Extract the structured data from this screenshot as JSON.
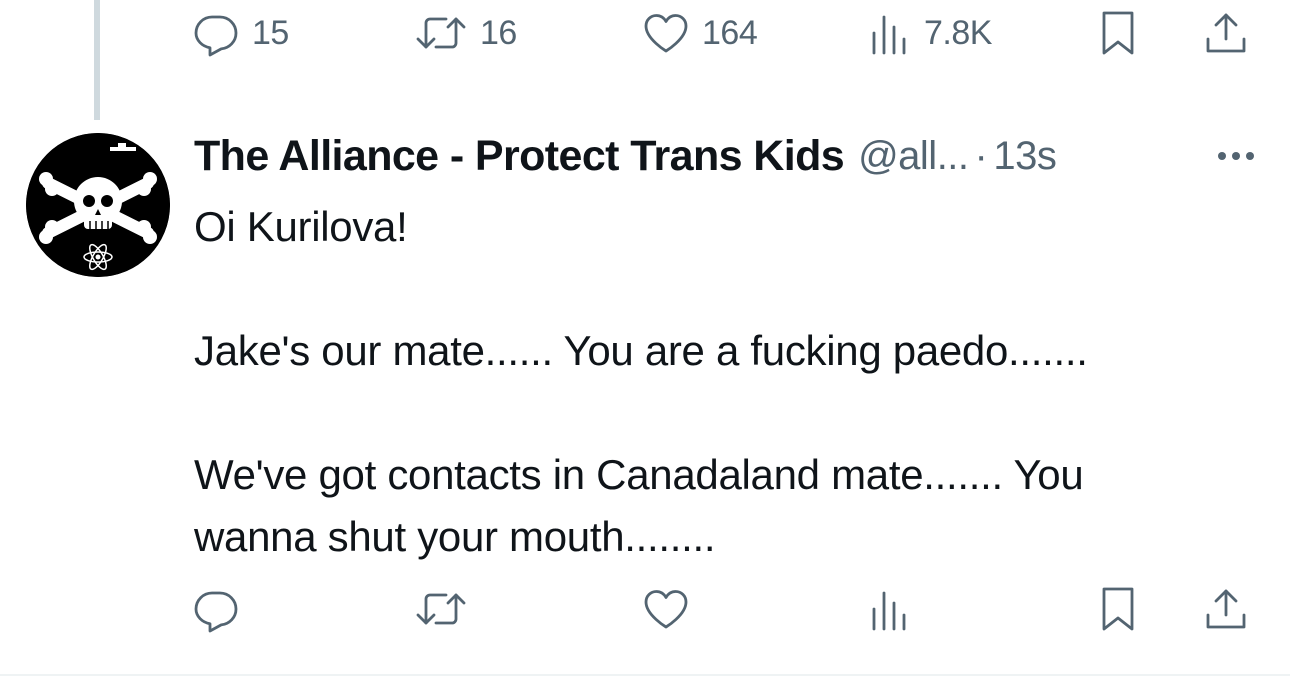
{
  "previous_tweet": {
    "actions": {
      "reply_count": "15",
      "retweet_count": "16",
      "like_count": "164",
      "views_count": "7.8K"
    }
  },
  "tweet": {
    "author": {
      "display_name": "The Alliance - Protect Trans Kids",
      "handle": "@all...",
      "avatar_icon": "skull-and-crossbones-icon"
    },
    "separator": "·",
    "timestamp": "13s",
    "body": {
      "line1": "Oi Kurilova!",
      "line2": "Jake's our mate......  You are a fucking paedo.......",
      "line3a": "We've got contacts in Canadaland mate.......  You",
      "line3b": "wanna shut your mouth........"
    },
    "actions": {
      "reply_count": "",
      "retweet_count": "",
      "like_count": "",
      "views_count": ""
    }
  },
  "colors": {
    "text_primary": "#0f1419",
    "text_secondary": "#536471",
    "thread_line": "#cfd9de",
    "background": "#ffffff"
  }
}
